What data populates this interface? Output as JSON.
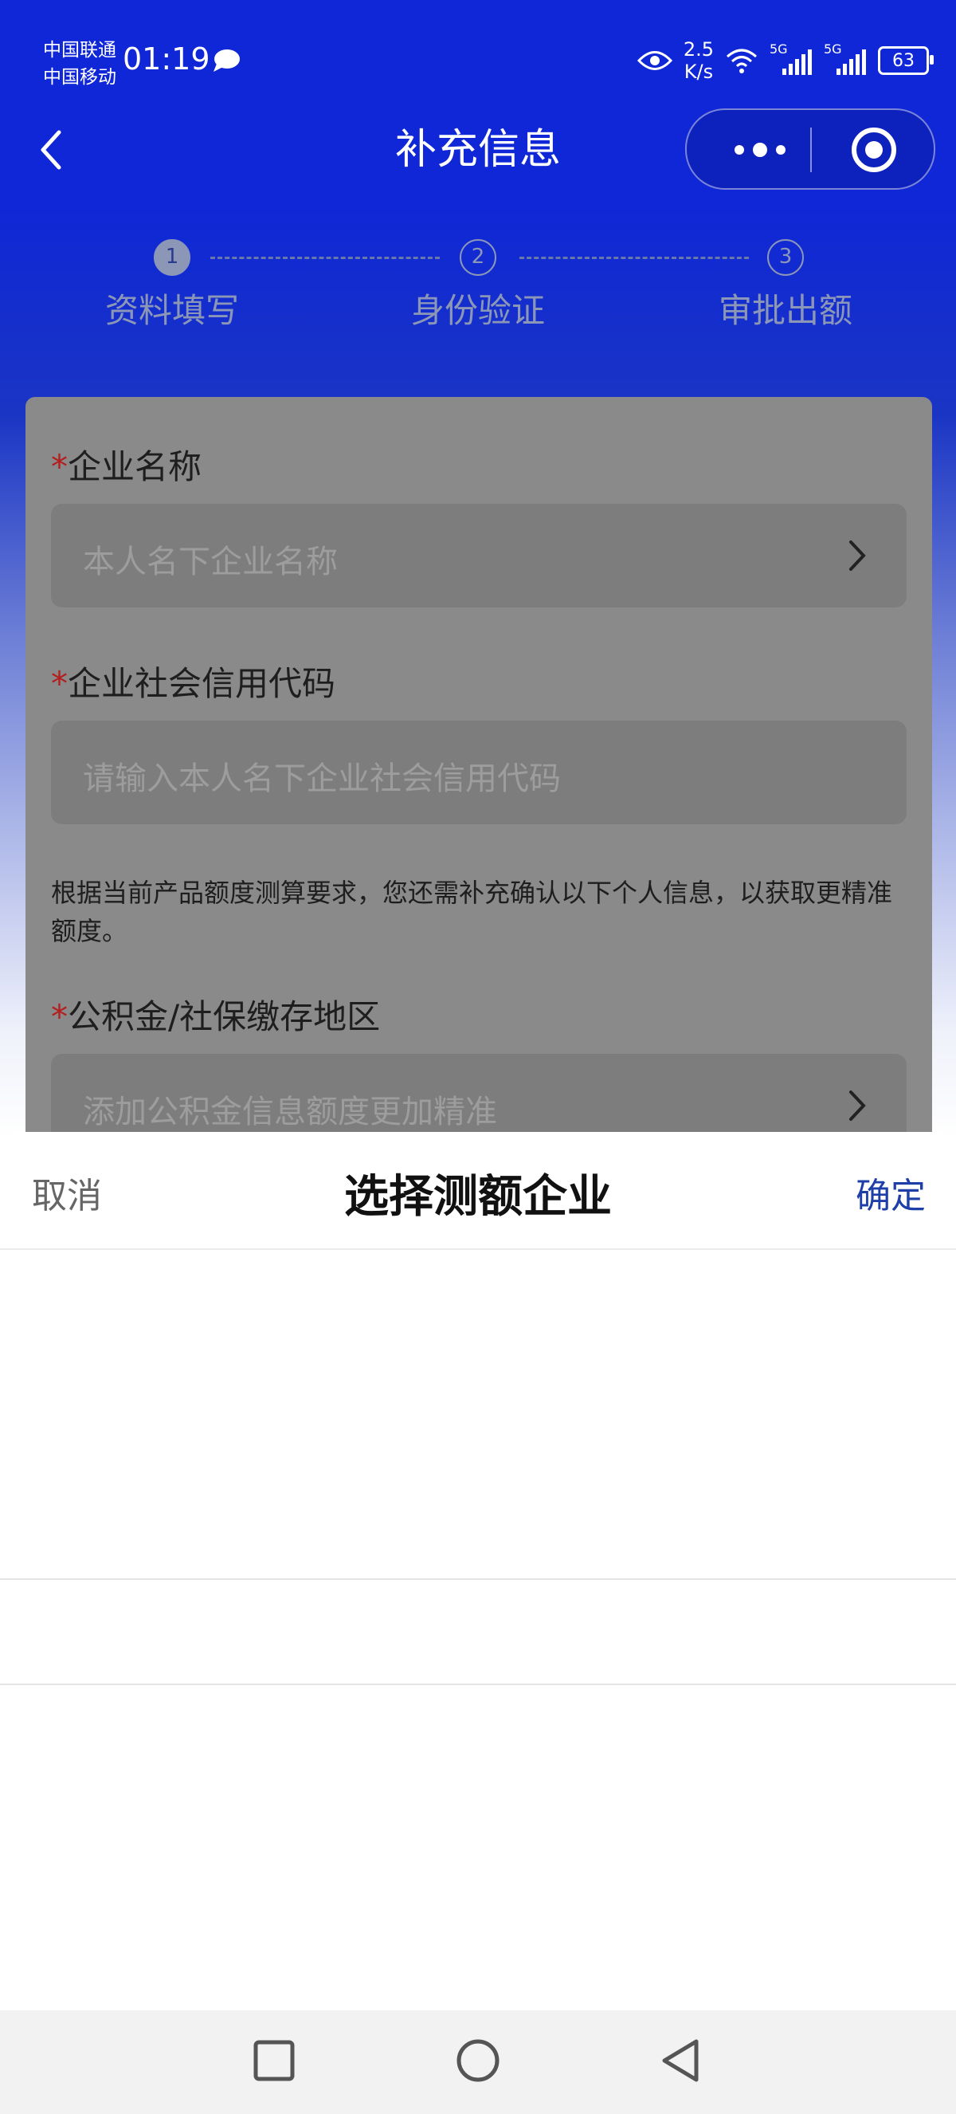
{
  "status_bar": {
    "carrier_1": "中国联通",
    "carrier_2": "中国移动",
    "time": "01:19",
    "net_speed_value": "2.5",
    "net_speed_unit": "K/s",
    "signal_1": "5G",
    "signal_2": "5G",
    "battery": "63"
  },
  "nav": {
    "title": "补充信息"
  },
  "steps": [
    {
      "num": "1",
      "label": "资料填写",
      "active": true
    },
    {
      "num": "2",
      "label": "身份验证",
      "active": false
    },
    {
      "num": "3",
      "label": "审批出额",
      "active": false
    }
  ],
  "form": {
    "company_name": {
      "required": "*",
      "label": "企业名称",
      "placeholder": "本人名下企业名称"
    },
    "credit_code": {
      "required": "*",
      "label": "企业社会信用代码",
      "placeholder": "请输入本人名下企业社会信用代码"
    },
    "note": "根据当前产品额度测算要求，您还需补充确认以下个人信息，以获取更精准额度。",
    "fund_region": {
      "required": "*",
      "label": "公积金/社保缴存地区",
      "placeholder": "添加公积金信息额度更加精准"
    }
  },
  "sheet": {
    "cancel": "取消",
    "title": "选择测额企业",
    "confirm": "确定"
  },
  "colors": {
    "header_blue": "#0f27d6",
    "confirm_blue": "#1e3fa8",
    "required_red": "#b41e1e"
  }
}
